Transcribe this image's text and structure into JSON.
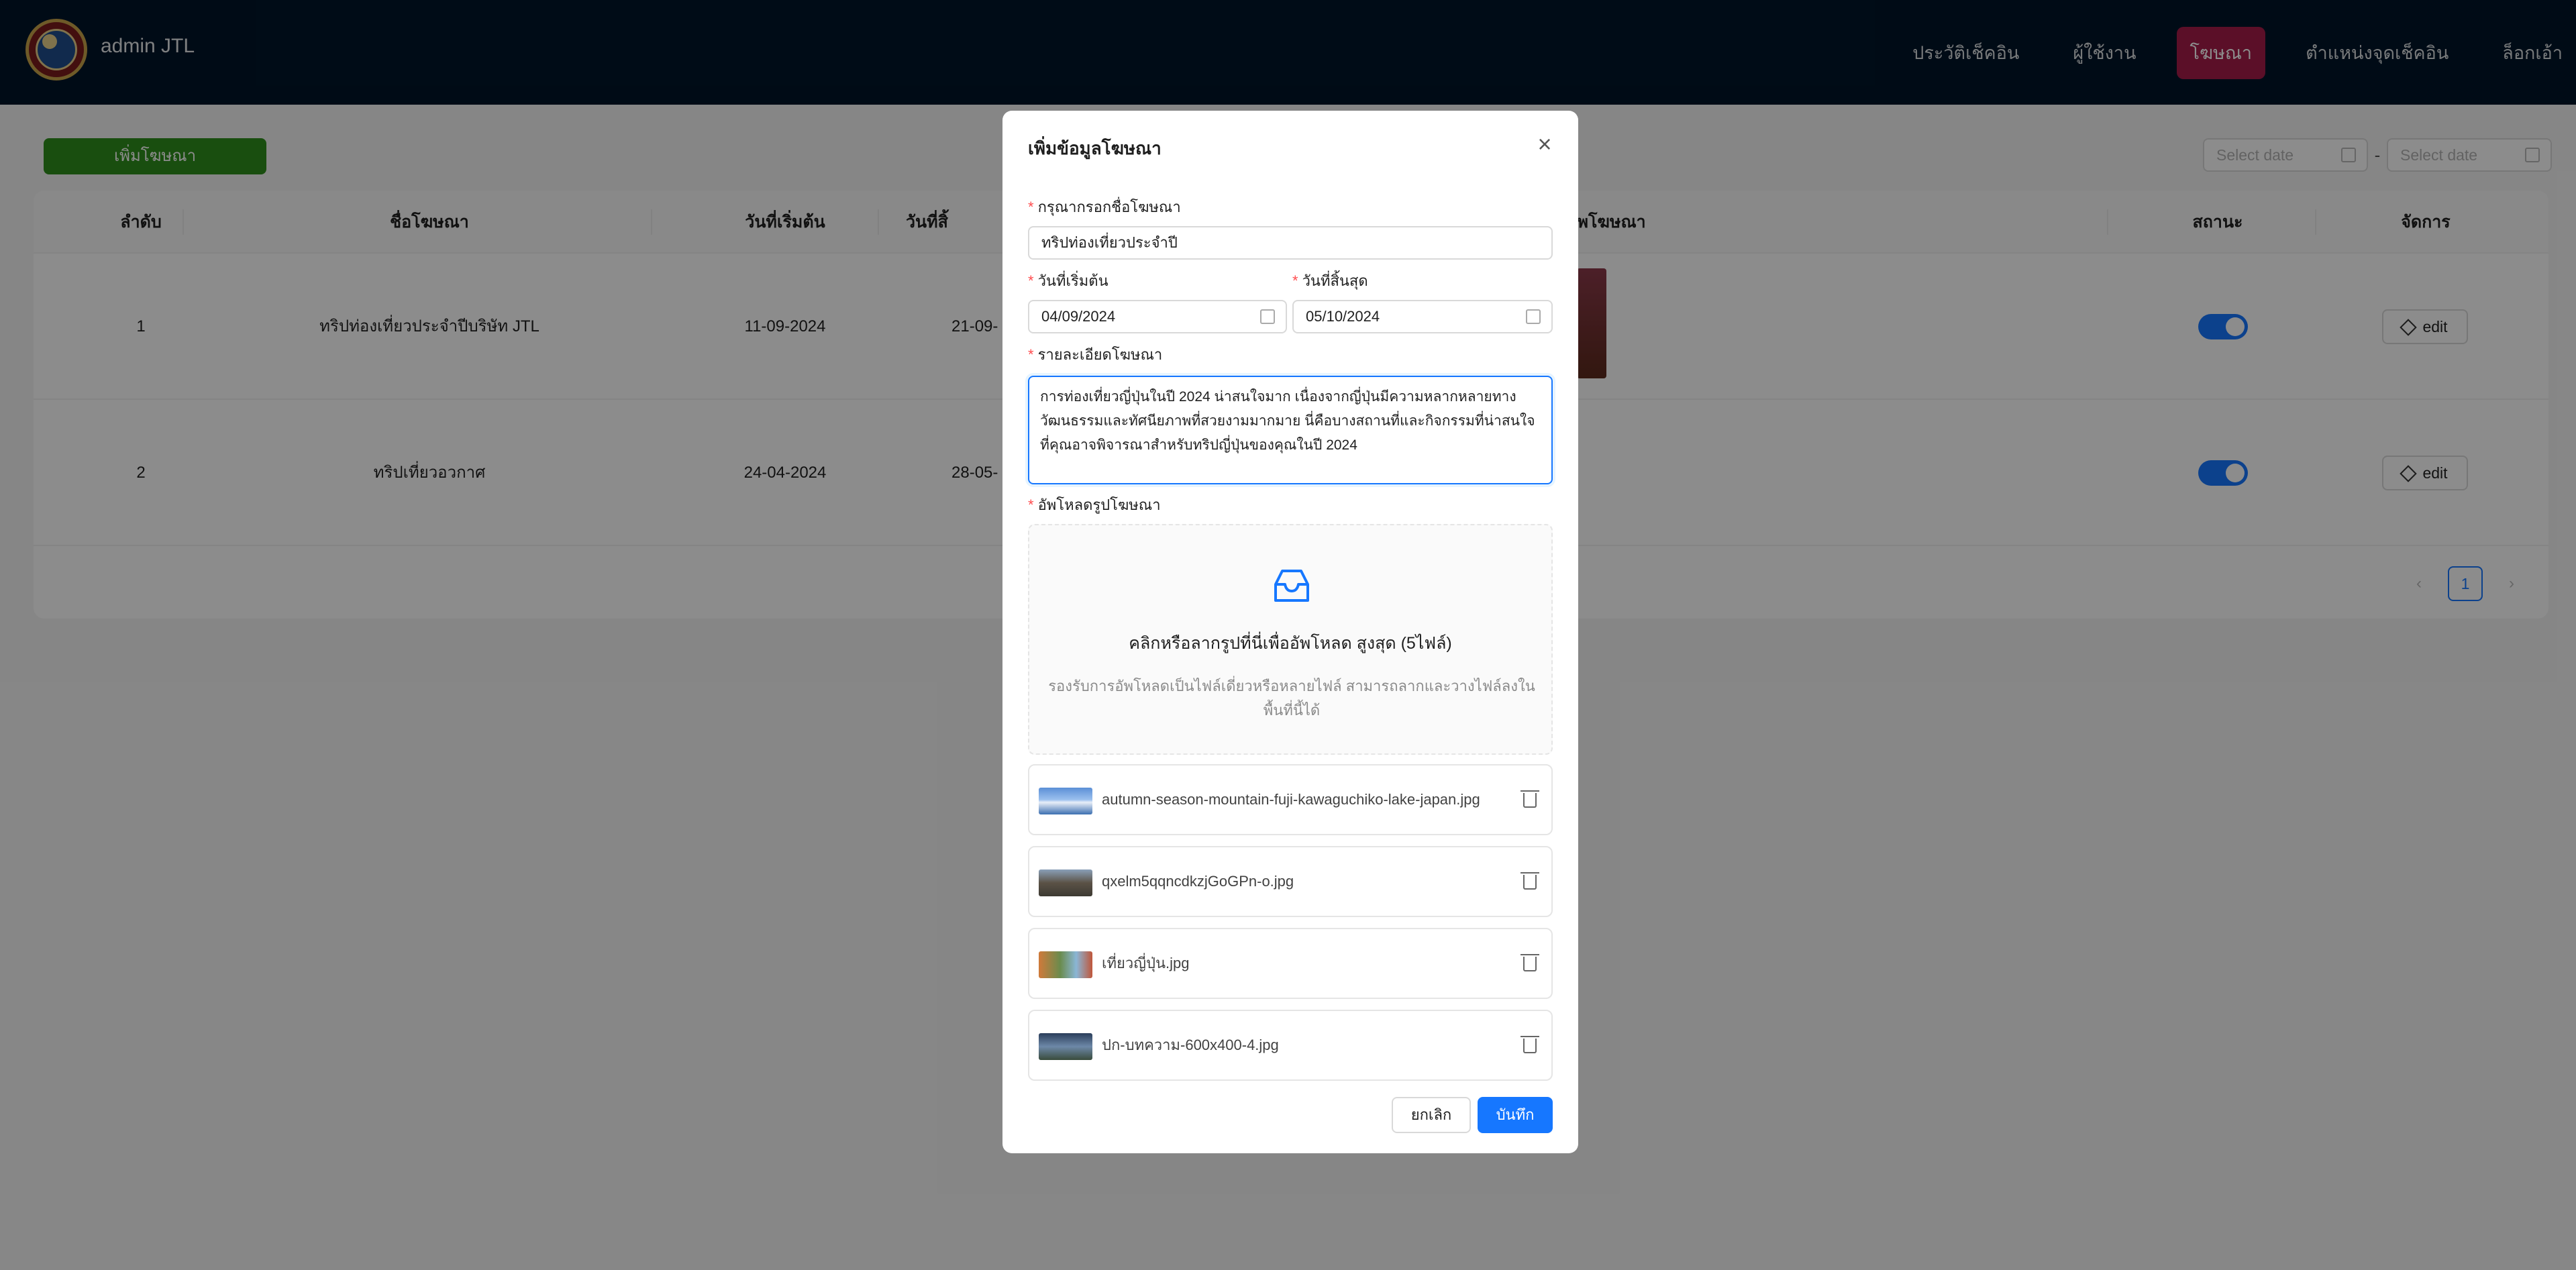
{
  "header": {
    "brand": "admin JTL",
    "nav": [
      "ประวัติเช็คอิน",
      "ผู้ใช้งาน",
      "โฆษณา",
      "ตำแหน่งจุดเช็คอิน",
      "ล็อกเอ้า"
    ],
    "active_nav": "โฆษณา"
  },
  "toolbar": {
    "add_label": "เพิ่มโฆษณา",
    "date_start_placeholder": "Select date",
    "date_end_placeholder": "Select date",
    "date_separator": "-"
  },
  "table": {
    "columns": [
      "ลำดับ",
      "ชื่อโฆษณา",
      "วันที่เริ่มต้น",
      "วันที่สิ้",
      "ภาพโฆษณา",
      "สถานะ",
      "จัดการ"
    ],
    "rows": [
      {
        "no": "1",
        "name": "ทริปท่องเที่ยวประจำปีบริษัท JTL",
        "start": "11-09-2024",
        "end": "21-09-",
        "status_on": true,
        "action": "edit"
      },
      {
        "no": "2",
        "name": "ทริปเที่ยวอวกาศ",
        "start": "24-04-2024",
        "end": "28-05-",
        "status_on": true,
        "action": "edit"
      }
    ],
    "current_page": "1"
  },
  "modal": {
    "title": "เพิ่มข้อมูลโฆษณา",
    "name_label": "กรุณากรอกชื่อโฆษณา",
    "name_value": "ทริปท่องเที่ยวประจำปี",
    "start_label": "วันที่เริ่มต้น",
    "start_value": "04/09/2024",
    "end_label": "วันที่สิ้นสุด",
    "end_value": "05/10/2024",
    "detail_label": "รายละเอียดโฆษณา",
    "detail_value": "การท่องเที่ยวญี่ปุ่นในปี 2024 น่าสนใจมาก เนื่องจากญี่ปุ่นมีความหลากหลายทางวัฒนธรรมและทัศนียภาพที่สวยงามมากมาย นี่คือบางสถานที่และกิจกรรมที่น่าสนใจที่คุณอาจพิจารณาสำหรับทริปญี่ปุ่นของคุณในปี 2024",
    "upload_label": "อัพโหลดรูปโฆษณา",
    "upload_title": "คลิกหรือลากรูปที่นี่เพื่ออัพโหลด สูงสุด (5ไฟล์)",
    "upload_hint": "รองรับการอัพโหลดเป็นไฟล์เดี่ยวหรือหลายไฟล์ สามารถลากและวางไฟล์ลงในพื้นที่นี้ได้",
    "files": [
      "autumn-season-mountain-fuji-kawaguchiko-lake-japan.jpg",
      "qxelm5qqncdkzjGoGPn-o.jpg",
      "เที่ยวญี่ปุ่น.jpg",
      "ปก-บทความ-600x400-4.jpg"
    ],
    "cancel_label": "ยกเลิก",
    "save_label": "บันทึก"
  },
  "colors": {
    "header_bg": "#001529",
    "active_nav_bg": "#a61d4a",
    "add_button_bg": "#2f8f1c",
    "primary": "#1677ff",
    "required_mark": "#ff4d4f"
  },
  "icons": [
    "close-icon",
    "calendar-icon",
    "inbox-icon",
    "trash-icon",
    "edit-icon",
    "chevron-left-icon",
    "chevron-right-icon"
  ]
}
